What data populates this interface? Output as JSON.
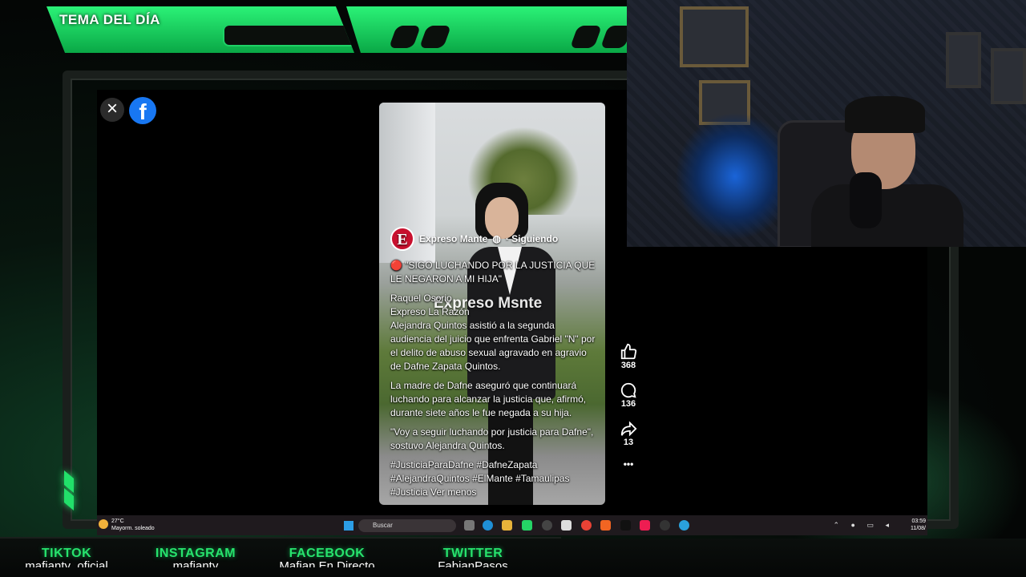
{
  "banner": {
    "title": "TEMA DEL DÍA"
  },
  "viewer": {
    "close_label": "×",
    "facebook_glyph": "f",
    "post": {
      "page_initial": "E",
      "page_name": "Expreso Mante",
      "follow_status": "· Siguiendo",
      "watermark": "Expreso Msnte",
      "caption_lines": [
        "🔴 \"SIGO LUCHANDO POR LA JUSTICIA QUE LE NEGARON A MI HIJA\"",
        "Raquel Osorio",
        "Expreso La Razón",
        "Alejandra Quintos asistió a la segunda audiencia del juicio que enfrenta Gabriel \"N\" por el delito de abuso sexual agravado en agravio de Dafne Zapata Quintos.",
        "La madre de Dafne aseguró que continuará luchando para alcanzar la justicia que, afirmó, durante siete años le fue negada a su hija.",
        "\"Voy a seguir luchando por justicia para Dafne\", sostuvo Alejandra Quintos."
      ],
      "hashtags": "#JusticiaParaDafne #DafneZapata #AlejandraQuintos #ElMante #Tamaulipas #Justicia",
      "see_less": "Ver menos"
    },
    "actions": {
      "likes": "368",
      "comments": "136",
      "shares": "13",
      "more": "•••"
    }
  },
  "taskbar": {
    "weather_temp": "27°C",
    "weather_desc": "Mayorm. soleado",
    "search_placeholder": "Buscar",
    "time": "03:59",
    "date": "11/08/"
  },
  "socials": [
    {
      "label": "TIKTOK",
      "handle": "mafianty_oficial"
    },
    {
      "label": "INSTAGRAM",
      "handle": "mafianty"
    },
    {
      "label": "FACEBOOK",
      "handle": "Mafian En Directo"
    },
    {
      "label": "TWITTER",
      "handle": "FabianPasos"
    }
  ],
  "colors": {
    "accent_green": "#27e36d",
    "facebook_blue": "#1877f2",
    "brand_red": "#c8102e"
  }
}
